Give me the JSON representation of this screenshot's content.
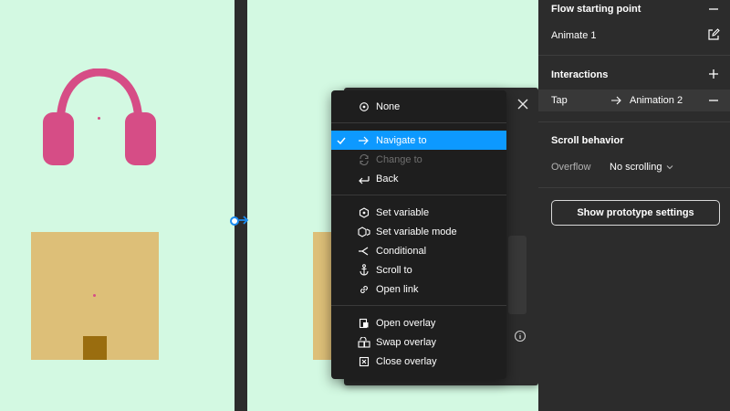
{
  "menu": {
    "items": [
      {
        "label": "None",
        "icon": "circle-dot-icon",
        "checked": false,
        "disabled": false
      },
      {
        "label": "Navigate to",
        "icon": "arrow-right-icon",
        "checked": true,
        "disabled": false
      },
      {
        "label": "Change to",
        "icon": "swap-cycle-icon",
        "checked": false,
        "disabled": true
      },
      {
        "label": "Back",
        "icon": "arrow-back-icon",
        "checked": false,
        "disabled": false
      },
      {
        "label": "Set variable",
        "icon": "variable-icon",
        "checked": false,
        "disabled": false
      },
      {
        "label": "Set variable mode",
        "icon": "variable-mode-icon",
        "checked": false,
        "disabled": false
      },
      {
        "label": "Conditional",
        "icon": "branch-icon",
        "checked": false,
        "disabled": false
      },
      {
        "label": "Scroll to",
        "icon": "anchor-icon",
        "checked": false,
        "disabled": false
      },
      {
        "label": "Open link",
        "icon": "link-icon",
        "checked": false,
        "disabled": false
      },
      {
        "label": "Open overlay",
        "icon": "open-overlay-icon",
        "checked": false,
        "disabled": false
      },
      {
        "label": "Swap overlay",
        "icon": "swap-overlay-icon",
        "checked": false,
        "disabled": false
      },
      {
        "label": "Close overlay",
        "icon": "close-overlay-icon",
        "checked": false,
        "disabled": false
      }
    ]
  },
  "properties": {
    "flow_starting_point": {
      "title": "Flow starting point",
      "name": "Animate 1"
    },
    "interactions": {
      "title": "Interactions",
      "trigger": "Tap",
      "destination": "Animation 2"
    },
    "scroll_behavior": {
      "title": "Scroll behavior",
      "overflow_label": "Overflow",
      "overflow_value": "No scrolling"
    },
    "prototype_settings_button": "Show prototype settings"
  },
  "colors": {
    "canvas_background": "#d3f9e2",
    "headphones": "#d64d86",
    "card": "#ddbf78",
    "card_inner": "#9a6d0f",
    "menu_active": "#0d99ff",
    "panel": "#2c2c2c",
    "menu": "#1e1e1e"
  }
}
